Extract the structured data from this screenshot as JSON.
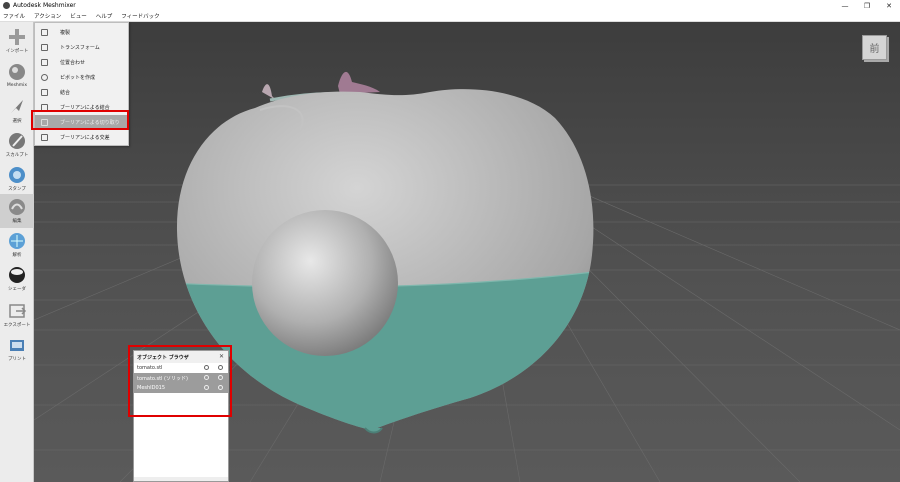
{
  "window": {
    "title": "Autodesk Meshmixer",
    "controls": [
      "—",
      "❐",
      "✕"
    ]
  },
  "menubar": [
    {
      "name": "menu-file",
      "label": "ファイル"
    },
    {
      "name": "menu-action",
      "label": "アクション"
    },
    {
      "name": "menu-view",
      "label": "ビュー"
    },
    {
      "name": "menu-help",
      "label": "ヘルプ"
    },
    {
      "name": "menu-feedback",
      "label": "フィードバック"
    }
  ],
  "toolbar": [
    {
      "name": "tool-import",
      "label": "インポート",
      "icon": "plus-icon"
    },
    {
      "name": "tool-meshmix",
      "label": "Meshmix",
      "icon": "meshmix-icon"
    },
    {
      "name": "tool-select",
      "label": "選択",
      "icon": "arrow-icon"
    },
    {
      "name": "tool-sculpt",
      "label": "スカルプト",
      "icon": "brush-icon"
    },
    {
      "name": "tool-stamp",
      "label": "スタンプ",
      "icon": "stamp-icon"
    },
    {
      "name": "tool-edit",
      "label": "編集",
      "icon": "edit-icon",
      "active": true
    },
    {
      "name": "tool-analysis",
      "label": "解析",
      "icon": "analysis-icon"
    },
    {
      "name": "tool-shaders",
      "label": "シェーダ",
      "icon": "shader-sphere-icon"
    },
    {
      "name": "tool-export",
      "label": "エクスポート",
      "icon": "export-icon"
    },
    {
      "name": "tool-print",
      "label": "プリント",
      "icon": "printer-icon"
    }
  ],
  "edit_menu": [
    {
      "label": "複製",
      "icon": "duplicate-icon"
    },
    {
      "label": "トランスフォーム",
      "icon": "transform-icon"
    },
    {
      "label": "位置合わせ",
      "icon": "align-icon"
    },
    {
      "label": "ピボットを作成",
      "icon": "pivot-icon"
    },
    {
      "label": "結合",
      "icon": "combine-icon"
    },
    {
      "label": "ブーリアンによる結合",
      "icon": "boolean-union-icon"
    },
    {
      "label": "ブーリアンによる切り取り",
      "icon": "boolean-difference-icon",
      "highlighted": true
    },
    {
      "label": "ブーリアンによる交差",
      "icon": "boolean-intersect-icon"
    }
  ],
  "viewcube": {
    "label": "前"
  },
  "object_browser": {
    "title": "オブジェクト ブラウザ",
    "items": [
      {
        "name": "tomato.stl",
        "selected": false
      },
      {
        "name": "tomato.stl (ソリッド)",
        "selected": true
      },
      {
        "name": "MeshID015",
        "selected": true
      }
    ]
  },
  "colors": {
    "highlight_box": "#e00000",
    "mesh_gray": "#a8a8a8",
    "mesh_teal": "#5d9f94"
  }
}
